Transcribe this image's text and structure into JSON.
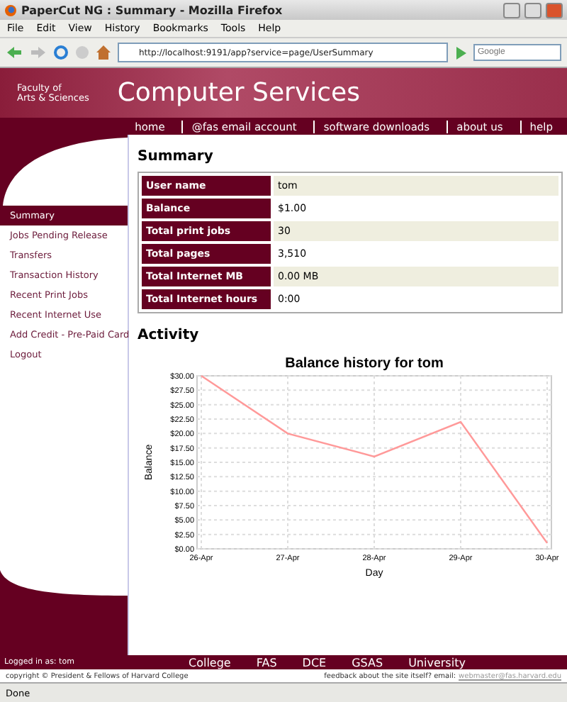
{
  "window": {
    "title": "PaperCut NG : Summary - Mozilla Firefox"
  },
  "menu": [
    "File",
    "Edit",
    "View",
    "History",
    "Bookmarks",
    "Tools",
    "Help"
  ],
  "toolbar": {
    "url": "http://localhost:9191/app?service=page/UserSummary",
    "search_placeholder": "Google"
  },
  "banner": {
    "org_lines": [
      "Faculty of",
      "Arts & Sciences"
    ],
    "title": "Computer Services"
  },
  "nav": [
    "home",
    "@fas email account",
    "software downloads",
    "about us",
    "help"
  ],
  "sidebar": {
    "items": [
      {
        "label": "Summary",
        "selected": true
      },
      {
        "label": "Jobs Pending Release",
        "selected": false
      },
      {
        "label": "Transfers",
        "selected": false
      },
      {
        "label": "Transaction History",
        "selected": false
      },
      {
        "label": "Recent Print Jobs",
        "selected": false
      },
      {
        "label": "Recent Internet Use",
        "selected": false
      },
      {
        "label": "Add Credit - Pre-Paid Card",
        "selected": false
      },
      {
        "label": "Logout",
        "selected": false
      }
    ]
  },
  "summary": {
    "heading": "Summary",
    "rows": [
      {
        "label": "User name",
        "value": "tom"
      },
      {
        "label": "Balance",
        "value": "$1.00"
      },
      {
        "label": "Total print jobs",
        "value": "30"
      },
      {
        "label": "Total pages",
        "value": "3,510"
      },
      {
        "label": "Total Internet MB",
        "value": "0.00 MB"
      },
      {
        "label": "Total Internet hours",
        "value": "0:00"
      }
    ]
  },
  "activity": {
    "heading": "Activity",
    "chart_data": {
      "type": "line",
      "title": "Balance history for tom",
      "xlabel": "Day",
      "ylabel": "Balance",
      "categories": [
        "26-Apr",
        "27-Apr",
        "28-Apr",
        "29-Apr",
        "30-Apr"
      ],
      "series": [
        {
          "color": "#ff9999",
          "values": [
            30,
            20,
            16,
            22,
            1
          ]
        }
      ],
      "grid": true,
      "ylim": [
        0,
        30
      ],
      "yticks": [
        {
          "value": 0,
          "label": "$0.00"
        },
        {
          "value": 2.5,
          "label": "$2.50"
        },
        {
          "value": 5,
          "label": "$5.00"
        },
        {
          "value": 7.5,
          "label": "$7.50"
        },
        {
          "value": 10,
          "label": "$10.00"
        },
        {
          "value": 12.5,
          "label": "$12.50"
        },
        {
          "value": 15,
          "label": "$15.00"
        },
        {
          "value": 17.5,
          "label": "$17.50"
        },
        {
          "value": 20,
          "label": "$20.00"
        },
        {
          "value": 22.5,
          "label": "$22.50"
        },
        {
          "value": 25,
          "label": "$25.00"
        },
        {
          "value": 27.5,
          "label": "$27.50"
        },
        {
          "value": 30,
          "label": "$30.00"
        }
      ]
    }
  },
  "footer": {
    "logged_in_label": "Logged in as:",
    "user": "tom",
    "links": [
      "College",
      "FAS",
      "DCE",
      "GSAS",
      "University"
    ],
    "copyright": "copyright © President & Fellows of Harvard College",
    "feedback": "feedback about the site itself? email:",
    "email": "webmaster@fas.harvard.edu"
  },
  "status_bar": {
    "text": "Done"
  }
}
